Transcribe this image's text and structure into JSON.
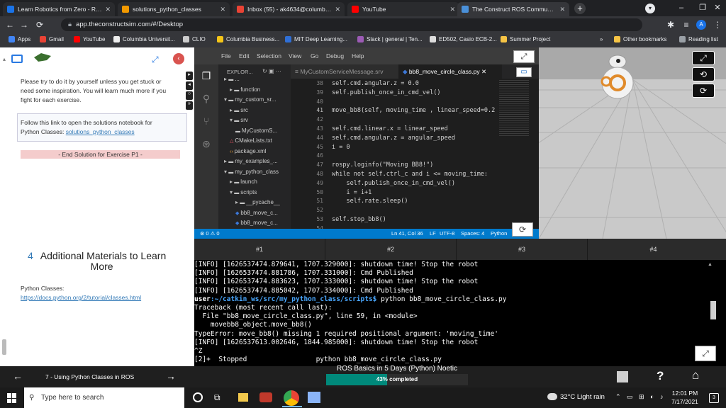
{
  "browser": {
    "tabs": [
      {
        "title": "Learn Robotics from Zero - Robo",
        "color": "#1a73e8",
        "active": false
      },
      {
        "title": "solutions_python_classes",
        "color": "#f29900",
        "active": false
      },
      {
        "title": "Inbox (55) - ak4634@columbia.e",
        "color": "#ea4335",
        "active": false
      },
      {
        "title": "YouTube",
        "color": "#ff0000",
        "active": false
      },
      {
        "title": "The Construct ROS Community -",
        "color": "#4a90d9",
        "active": true
      }
    ],
    "url": "app.theconstructsim.com/#/Desktop",
    "profile_initial": "A",
    "bookmarks": [
      {
        "label": "Apps",
        "color": "#4285f4"
      },
      {
        "label": "Gmail",
        "color": "#ea4335"
      },
      {
        "label": "YouTube",
        "color": "#ff0000"
      },
      {
        "label": "Columbia Universit...",
        "color": "#eeeeee"
      },
      {
        "label": "CLIO",
        "color": "#cccccc"
      },
      {
        "label": "Columbia Business...",
        "color": "#f5c518"
      },
      {
        "label": "MIT Deep Learning...",
        "color": "#2f6fd6"
      },
      {
        "label": "Slack | general | Ten...",
        "color": "#9c5bb5"
      },
      {
        "label": "ED502, Casio ECB-2...",
        "color": "#dddddd"
      },
      {
        "label": "Summer Project",
        "color": "#f6c445"
      }
    ],
    "more_chevron": "»",
    "other_bookmarks": "Other bookmarks",
    "reading_list": "Reading list"
  },
  "notebook": {
    "para1": [
      "Please try to do it by yourself unless you get stuck or",
      "need some inspiration. You will learn much more if you",
      "fight for each exercise."
    ],
    "callout_line1": "Follow this link to open the solutions notebook for",
    "callout_line2_prefix": "Python Classes: ",
    "callout_link": "solutions_python_classes",
    "end_solution": "- End Solution for Exercise P1 -",
    "section_number": "4",
    "section_title_1": "Additional Materials to Learn",
    "section_title_2": "More",
    "python_classes_label": "Python Classes:",
    "python_classes_link": "https://docs.python.org/2/tutorial/classes.html"
  },
  "vscode": {
    "menu": [
      "File",
      "Edit",
      "Selection",
      "View",
      "Go",
      "Debug",
      "Help"
    ],
    "explorer_title": "EXPLOR...",
    "tree": [
      {
        "indent": 0,
        "arrow": "▸",
        "icon": "folder",
        "label": "..."
      },
      {
        "indent": 1,
        "arrow": "▸",
        "icon": "folder",
        "label": "function"
      },
      {
        "indent": 0,
        "arrow": "▾",
        "icon": "folder",
        "label": "my_custom_sr..."
      },
      {
        "indent": 1,
        "arrow": "▸",
        "icon": "folder",
        "label": "src"
      },
      {
        "indent": 1,
        "arrow": "▾",
        "icon": "folder",
        "label": "srv"
      },
      {
        "indent": 2,
        "arrow": "",
        "icon": "folder",
        "label": "MyCustomS..."
      },
      {
        "indent": 1,
        "arrow": "",
        "icon": "cmake",
        "label": "CMakeLists.txt"
      },
      {
        "indent": 1,
        "arrow": "",
        "icon": "xml",
        "label": "package.xml"
      },
      {
        "indent": 0,
        "arrow": "▸",
        "icon": "folder",
        "label": "my_examples_..."
      },
      {
        "indent": 0,
        "arrow": "▾",
        "icon": "folder",
        "label": "my_python_class"
      },
      {
        "indent": 1,
        "arrow": "▸",
        "icon": "folder",
        "label": "launch"
      },
      {
        "indent": 1,
        "arrow": "▾",
        "icon": "folder",
        "label": "scripts"
      },
      {
        "indent": 2,
        "arrow": "▸",
        "icon": "folder",
        "label": "__pycache__"
      },
      {
        "indent": 2,
        "arrow": "",
        "icon": "py",
        "label": "bb8_move_c..."
      },
      {
        "indent": 2,
        "arrow": "",
        "icon": "py",
        "label": "bb8_move_c..."
      }
    ],
    "tab1": "MyCustomServiceMessage.srv",
    "tab2": "bb8_move_circle_class.py",
    "code": [
      {
        "n": "38",
        "t": "self.cmd.angular.z = 0.0"
      },
      {
        "n": "39",
        "t": "self.publish_once_in_cmd_vel()"
      },
      {
        "n": "40",
        "t": ""
      },
      {
        "n": "41",
        "t": "move_bb8(self, moving_time , linear_speed=0.2"
      },
      {
        "n": "42",
        "t": ""
      },
      {
        "n": "43",
        "t": "self.cmd.linear.x = linear_speed"
      },
      {
        "n": "44",
        "t": "self.cmd.angular.z = angular_speed"
      },
      {
        "n": "45",
        "t": "i = 0"
      },
      {
        "n": "46",
        "t": ""
      },
      {
        "n": "47",
        "t": "rospy.loginfo(\"Moving BB8!\")"
      },
      {
        "n": "48",
        "t": "while not self.ctrl_c and i <= moving_time:"
      },
      {
        "n": "49",
        "t": "    self.publish_once_in_cmd_vel()"
      },
      {
        "n": "50",
        "t": "    i = i+1"
      },
      {
        "n": "51",
        "t": "    self.rate.sleep()"
      },
      {
        "n": "52",
        "t": ""
      },
      {
        "n": "53",
        "t": "self.stop_bb8()"
      },
      {
        "n": "54",
        "t": ""
      }
    ],
    "status_left": "⊗ 0 ⚠ 0",
    "status_pos": "Ln 41, Col 36",
    "status_eol": "LF",
    "status_enc": "UTF-8",
    "status_spaces": "Spaces: 4",
    "status_lang": "Python"
  },
  "terminal": {
    "tabs": [
      "#1",
      "#2",
      "#3",
      "#4"
    ],
    "lines": [
      "[INFO] [1626537474.879641, 1707.329000]: shutdown time! Stop the robot",
      "[INFO] [1626537474.881786, 1707.331000]: Cmd Published",
      "[INFO] [1626537474.883623, 1707.333000]: shutdown time! Stop the robot",
      "[INFO] [1626537474.885042, 1707.334000]: Cmd Published",
      "__PROMPT__",
      "Traceback (most recent call last):",
      "  File \"bb8_move_circle_class.py\", line 59, in <module>",
      "    movebb8_object.move_bb8()",
      "TypeError: move_bb8() missing 1 required positional argument: 'moving_time'",
      "[INFO] [1626537613.002646, 1844.985000]: shutdown time! Stop the robot",
      "^Z",
      "[2]+  Stopped                 python bb8_move_circle_class.py"
    ],
    "prompt_user": "user",
    "prompt_path": ":~/catkin_ws/src/my_python_class/scripts$",
    "prompt_cmd": " python bb8_move_circle_class.py"
  },
  "course": {
    "prev_unit": "7 - Using Python Classes in ROS",
    "title": "ROS Basics in 5 Days (Python) Noetic",
    "progress_label": "43% completed",
    "progress": 0.43
  },
  "taskbar": {
    "search_placeholder": "Type here to search",
    "weather": "32°C  Light rain",
    "time": "12:01 PM",
    "date": "7/17/2021",
    "notif_count": "3"
  }
}
